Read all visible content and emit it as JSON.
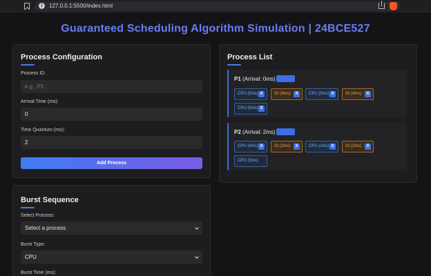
{
  "browser": {
    "url": "127.0.0.1:5500/index.html"
  },
  "page": {
    "title": "Guaranteed Scheduling Algorithm Simulation | 24BCE527"
  },
  "process_config": {
    "heading": "Process Configuration",
    "pid_label": "Process ID:",
    "pid_placeholder": "e.g., P1",
    "arrival_label": "Arrival Time (ms):",
    "arrival_value": "0",
    "quantum_label": "Time Quantum (ms):",
    "quantum_value": "2",
    "add_button": "Add Process"
  },
  "burst_sequence": {
    "heading": "Burst Sequence",
    "select_label": "Select Process:",
    "select_value": "Select a process",
    "type_label": "Burst Type:",
    "type_value": "CPU",
    "time_label": "Burst Time (ms):"
  },
  "process_list": {
    "heading": "Process List",
    "processes": [
      {
        "name": "P1",
        "arrival": "(Arrival: 0ms)",
        "bursts": [
          {
            "label": "CPU (5ms)",
            "type": "cpu"
          },
          {
            "label": "IO (4ms)",
            "type": "io"
          },
          {
            "label": "CPU (5ms)",
            "type": "cpu"
          },
          {
            "label": "IO (4ms)",
            "type": "io"
          },
          {
            "label": "CPU (5ms)",
            "type": "cpu"
          }
        ]
      },
      {
        "name": "P2",
        "arrival": "(Arrival: 2ms)",
        "bursts": [
          {
            "label": "CPU (4ms)",
            "type": "cpu"
          },
          {
            "label": "IO (2ms)",
            "type": "io"
          },
          {
            "label": "CPU (3ms)",
            "type": "cpu"
          },
          {
            "label": "IO (3ms)",
            "type": "io"
          },
          {
            "label": "CPU (3ms)",
            "type": "cpu"
          }
        ]
      }
    ],
    "remove_label": "X"
  },
  "colors": {
    "accent": "#3b6fe6",
    "title": "#6b7cf4",
    "cpu": "#7fb0ef",
    "io": "#e9a34e"
  }
}
